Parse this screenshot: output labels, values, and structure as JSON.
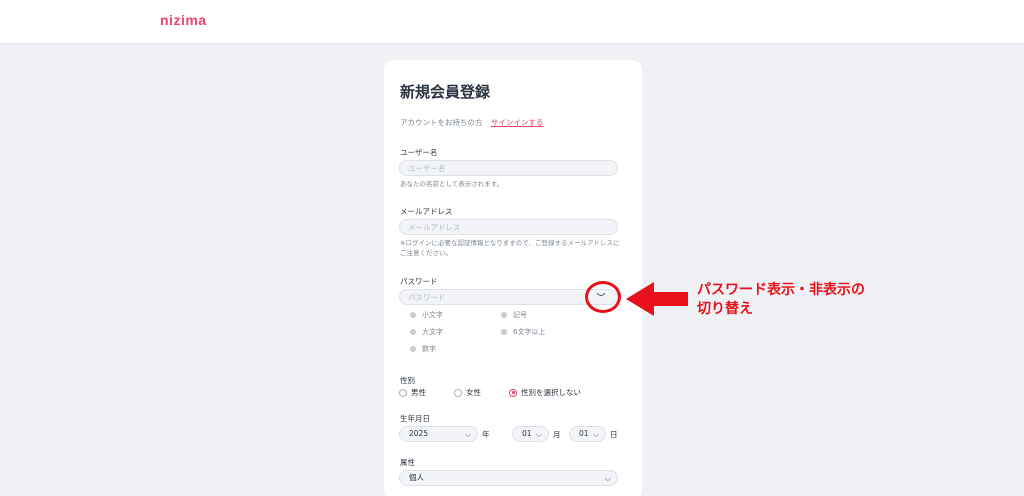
{
  "header": {
    "logo": "nizima"
  },
  "form": {
    "title": "新規会員登録",
    "signin_prompt": "アカウントをお持ちの方",
    "signin_link": "サインインする",
    "username": {
      "label": "ユーザー名",
      "placeholder": "ユーザー名",
      "hint": "あなたの名前として表示されます。"
    },
    "email": {
      "label": "メールアドレス",
      "placeholder": "メールアドレス",
      "hint": "※ログインに必要な認証情報となりますので、ご登録するメールアドレスにご注意ください。"
    },
    "password": {
      "label": "パスワード",
      "placeholder": "パスワード",
      "requirements": [
        "小文字",
        "記号",
        "大文字",
        "6文字以上",
        "数字"
      ]
    },
    "gender": {
      "label": "性別",
      "options": [
        "男性",
        "女性",
        "性別を選択しない"
      ],
      "selected": "性別を選択しない"
    },
    "birthdate": {
      "label": "生年月日",
      "year": "2025",
      "year_unit": "年",
      "month": "01",
      "month_unit": "月",
      "day": "01",
      "day_unit": "日"
    },
    "attribute": {
      "label": "属性",
      "value": "個人"
    }
  },
  "annotation": {
    "text_line1": "パスワード表示・非表示の",
    "text_line2": "切り替え",
    "color": "#e8101a"
  },
  "colors": {
    "accent": "#e8456b",
    "background": "#eff1f4"
  },
  "icons": {
    "password_toggle": "eye-closed-icon",
    "select": "chevron-down-icon"
  }
}
